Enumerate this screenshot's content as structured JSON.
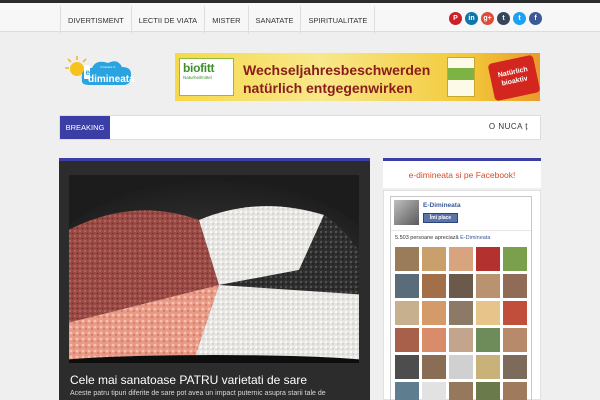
{
  "nav": {
    "items": [
      "DIVERTISMENT",
      "LECTII DE VIATA",
      "MISTER",
      "SANATATE",
      "SPIRITUALITATE"
    ]
  },
  "social": [
    {
      "icon": "pinterest-icon",
      "glyph": "P",
      "color": "#cb2027"
    },
    {
      "icon": "linkedin-icon",
      "glyph": "in",
      "color": "#0e76a8"
    },
    {
      "icon": "googleplus-icon",
      "glyph": "g+",
      "color": "#dd4b39"
    },
    {
      "icon": "tumblr-icon",
      "glyph": "t",
      "color": "#35465c"
    },
    {
      "icon": "twitter-icon",
      "glyph": "t",
      "color": "#1da1f2"
    },
    {
      "icon": "facebook-icon",
      "glyph": "f",
      "color": "#3b5998"
    }
  ],
  "logo": {
    "text": "dimineata"
  },
  "ad": {
    "brand": "biofitt",
    "brand_sub": "Naturheilmittel",
    "line1": "Wechseljahresbeschwerden",
    "line2": "natürlich entgegenwirken",
    "badge": "Natürlich bioaktiv"
  },
  "breaking": {
    "label": "BREAKING",
    "ticker": "O NUCA ț"
  },
  "featured": {
    "title": "Cele mai sanatoase PATRU varietati de sare",
    "excerpt": "Aceste patru tipuri diferite de sare pot avea un impact puternic asupra starii tale de"
  },
  "sidebar": {
    "heading": "e-dimineata si pe Facebook!",
    "page_name": "E-Dimineata",
    "like_label": "Îmi place",
    "count_text": "5.503 persoane apreciază",
    "count_link": "E-Dimineata"
  },
  "colors": {
    "accent": "#3b3ea5",
    "sidebar_heading": "#d84b2a",
    "facebook": "#3b5998"
  }
}
